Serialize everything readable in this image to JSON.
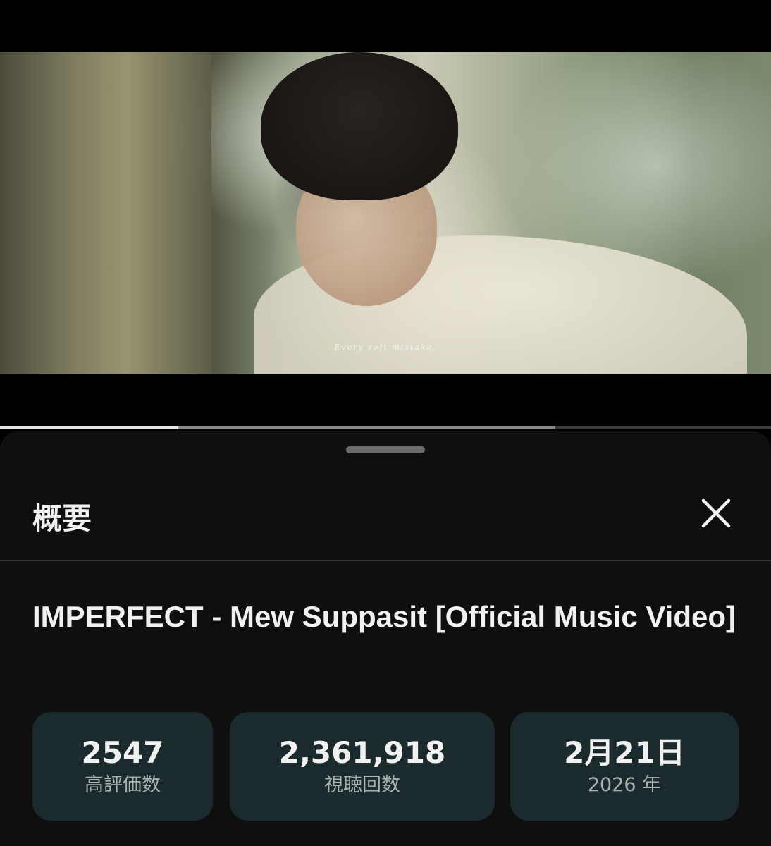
{
  "player": {
    "subtitle": "Every soft mistake,",
    "played_fraction": 0.23,
    "buffered_fraction": 0.72
  },
  "sheet": {
    "title": "概要",
    "close_icon": "close-icon",
    "video_title": "IMPERFECT - Mew Suppasit [Official Music Video]",
    "stats": [
      {
        "value": "2547",
        "label": "高評価数"
      },
      {
        "value": "2,361,918",
        "label": "視聴回数"
      },
      {
        "value": "2月21日",
        "label": "2026 年"
      }
    ]
  },
  "colors": {
    "sheet_bg": "#0f0f0f",
    "card_bg": "#1b2a2c",
    "text_primary": "#f1f1f1",
    "text_secondary": "#a9b1b2"
  }
}
